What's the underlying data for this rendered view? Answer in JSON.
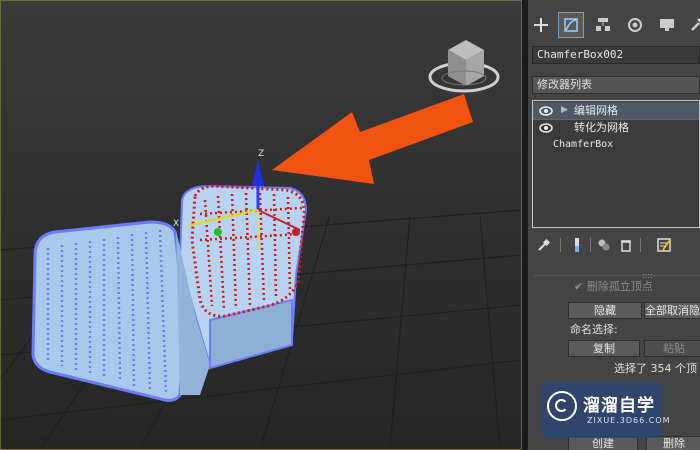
{
  "viewport": {
    "gizmo_axis_x": "X",
    "gizmo_axis_z": "Z",
    "arrow_color": "#f0520f",
    "selection_color": "#d81818",
    "mesh_vertex_color": "#6a7cff",
    "object_color": "#a9c8ea"
  },
  "panel": {
    "object_name": "ChamferBox002",
    "modifier_list_label": "修改器列表",
    "stack": [
      {
        "label": "编辑网格",
        "has_eye": true,
        "has_expand": true,
        "selected": true
      },
      {
        "label": "转化为网格",
        "has_eye": true,
        "has_expand": false,
        "selected": false
      },
      {
        "label": "ChamferBox",
        "has_eye": false,
        "has_expand": false,
        "selected": false
      }
    ],
    "partial_label": "删除孤立顶点",
    "hide_button": "隐藏",
    "unhide_all_button": "全部取消隐藏",
    "named_selection_label": "命名选择:",
    "copy_button": "复制",
    "paste_button": "粘贴",
    "selection_status": "选择了 354 个顶",
    "create_button": "创建",
    "delete_button": "删除"
  },
  "watermark": {
    "title": "溜溜自学",
    "subtitle": "ZIXUE.3D66.COM"
  }
}
